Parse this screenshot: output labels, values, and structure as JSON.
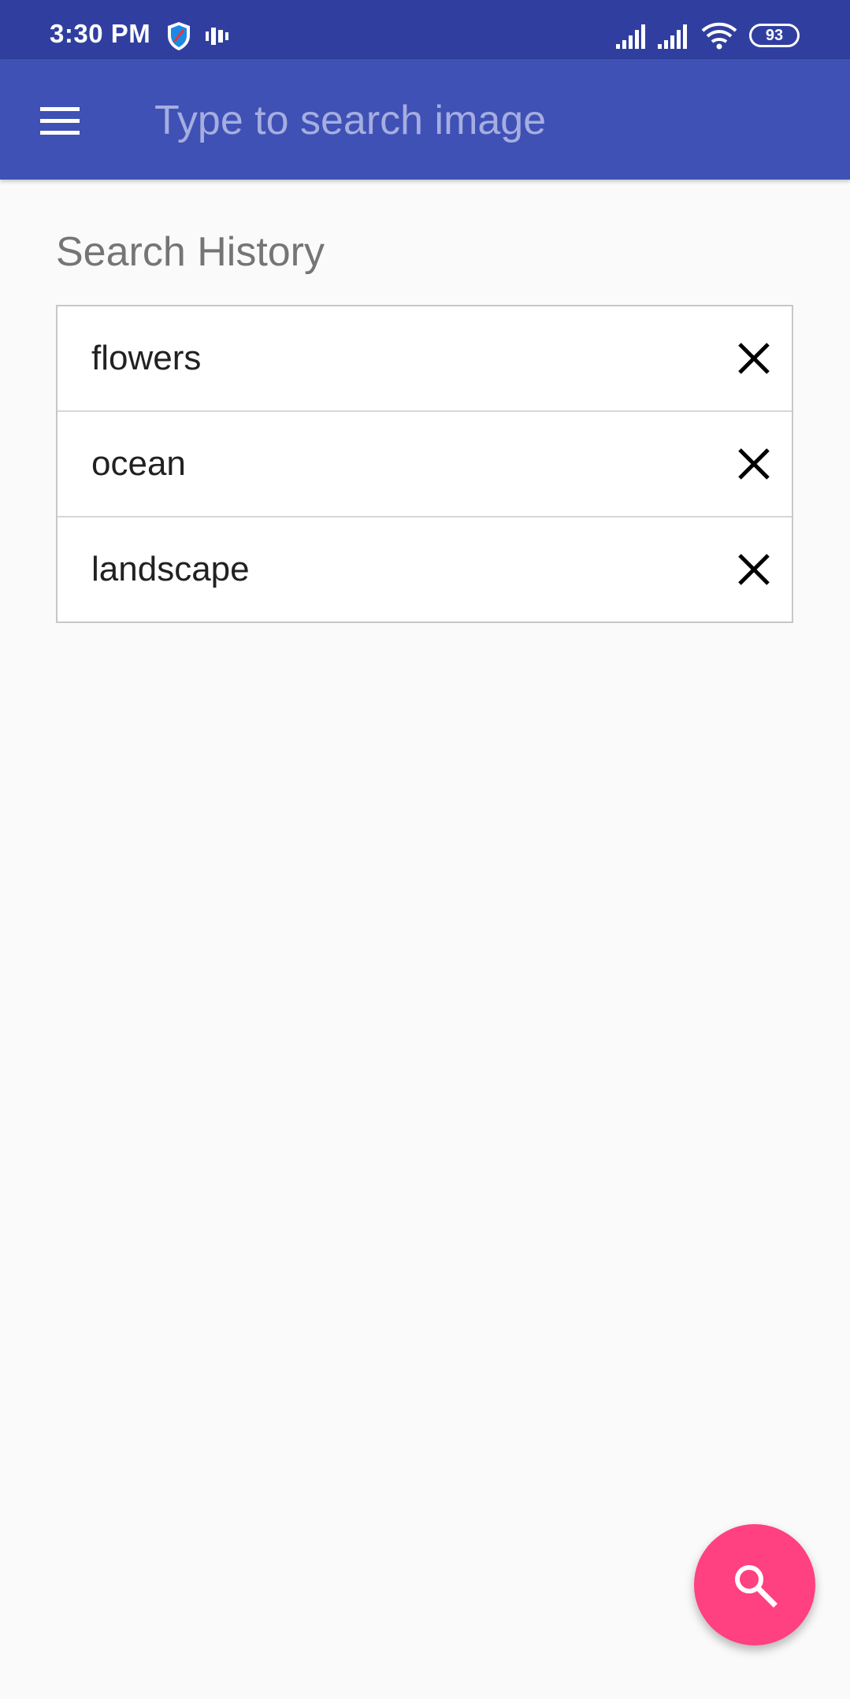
{
  "status_bar": {
    "time": "3:30 PM",
    "battery": "93",
    "icons": [
      "shield-icon",
      "vibrate-icon",
      "signal-icon",
      "signal-icon",
      "wifi-icon",
      "battery-icon"
    ]
  },
  "app_bar": {
    "menu_icon": "hamburger-menu-icon",
    "search_placeholder": "Type to search image",
    "background_color": "#3f51b5",
    "status_bar_color": "#303f9f"
  },
  "search_history": {
    "title": "Search History",
    "items": [
      {
        "label": "flowers",
        "remove_icon": "close-icon"
      },
      {
        "label": "ocean",
        "remove_icon": "close-icon"
      },
      {
        "label": "landscape",
        "remove_icon": "close-icon"
      }
    ]
  },
  "fab": {
    "icon": "search-icon",
    "color": "#ff4081"
  }
}
